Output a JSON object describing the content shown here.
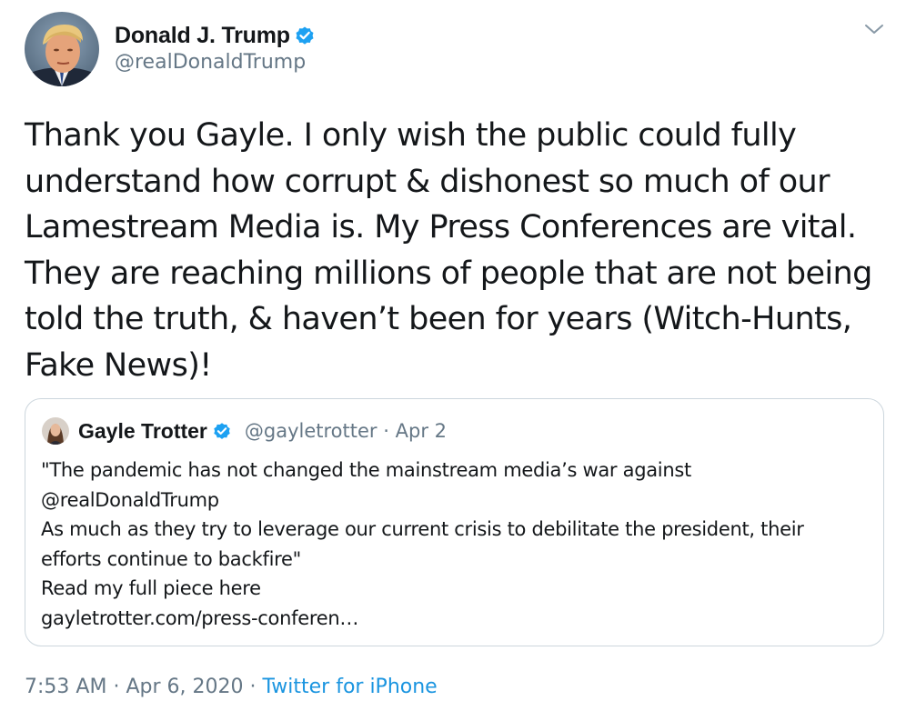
{
  "author": {
    "name": "Donald J. Trump",
    "handle": "@realDonaldTrump",
    "verified": true
  },
  "tweet": {
    "lines": [
      "Thank you Gayle. I only wish the public could fully",
      "understand how corrupt & dishonest so much of our",
      "Lamestream Media is. My Press Conferences are vital.",
      "They are reaching millions of people that are not being",
      "told the truth, & haven’t been for years (Witch-Hunts,",
      "Fake News)!"
    ]
  },
  "quote": {
    "name": "Gayle Trotter",
    "handle": "@gayletrotter",
    "separator": "·",
    "date": "Apr 2",
    "verified": true,
    "lines": [
      "\"The pandemic has not changed the mainstream media’s war against",
      "@realDonaldTrump",
      "As much as they try to leverage our current crisis to debilitate the president, their",
      "efforts continue to backfire\"",
      "Read my full piece here",
      "gayletrotter.com/press-conferen…"
    ]
  },
  "footer": {
    "time": "7:53 AM",
    "separator": "·",
    "date": "Apr 6, 2020",
    "source": "Twitter for iPhone"
  },
  "icons": {
    "verified": "verified-badge-icon",
    "menu": "chevron-down-icon"
  },
  "colors": {
    "text": "#14171a",
    "secondary": "#657786",
    "link": "#1b95e0",
    "verified": "#1da1f2",
    "border": "#ccd6dd"
  }
}
